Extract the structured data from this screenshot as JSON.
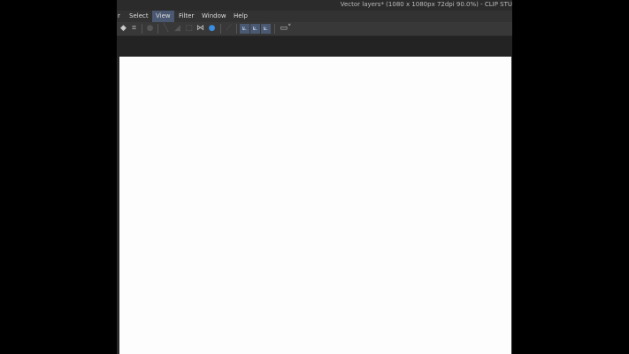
{
  "window": {
    "title": "Vector layers* (1080 x 1080px 72dpi 90.0%) - CLIP STU"
  },
  "menu": [
    {
      "label": "r"
    },
    {
      "label": "Select"
    },
    {
      "label": "View",
      "active": true
    },
    {
      "label": "Filter"
    },
    {
      "label": "Window"
    },
    {
      "label": "Help"
    }
  ],
  "toolbar": {
    "icons": [
      "fill-icon",
      "crop-icon",
      "disabled-icon",
      "line-icon",
      "gradient-icon",
      "square-icon",
      "flip-horizontal-icon",
      "color-icon",
      "pen-icon",
      "ruler-snap-icon",
      "ruler-snap-2-icon",
      "ruler-snap-3-icon",
      "display-icon"
    ]
  },
  "colors": {
    "accent": "#4a5872",
    "canvas": "#fdfdfd"
  }
}
